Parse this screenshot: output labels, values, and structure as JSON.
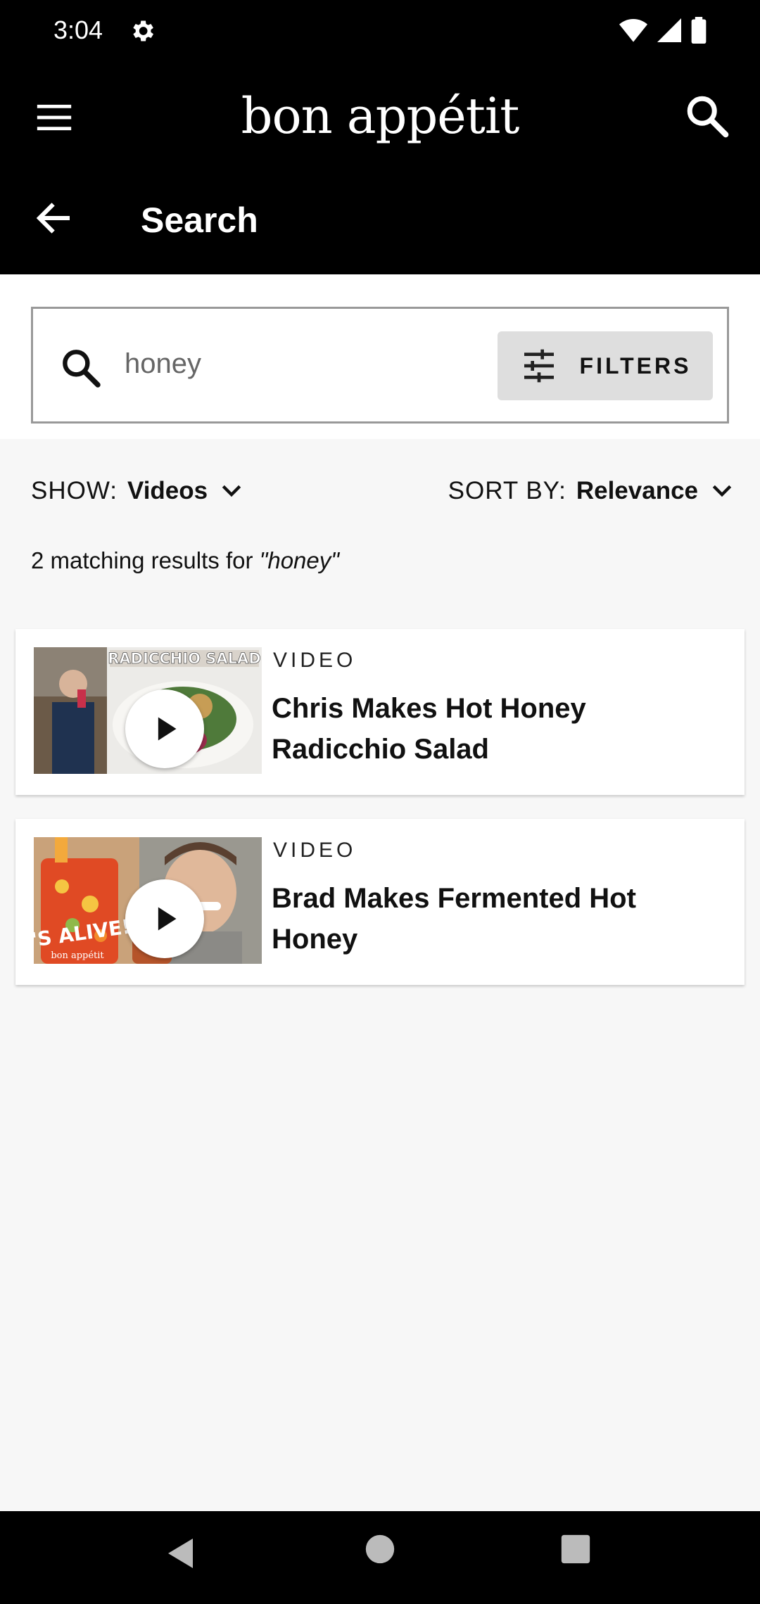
{
  "status_bar": {
    "time": "3:04"
  },
  "app_bar": {
    "brand": "bon appétit",
    "page_title": "Search"
  },
  "search": {
    "query": "honey",
    "filters_label": "FILTERS"
  },
  "controls": {
    "show_label": "SHOW:",
    "show_value": "Videos",
    "sort_label": "SORT BY:",
    "sort_value": "Relevance"
  },
  "results_summary": {
    "prefix": "2 matching results for ",
    "query": "\"honey\""
  },
  "results": [
    {
      "kind": "VIDEO",
      "title": "Chris Makes Hot Honey Radicchio Salad",
      "thumb_text": "RADICCHIO SALAD"
    },
    {
      "kind": "VIDEO",
      "title": "Brad Makes Fermented Hot Honey",
      "thumb_text": "IT'S ALIVE!",
      "thumb_subtext": "bon appétit"
    }
  ],
  "colors": {
    "header": "#000000",
    "background": "#f7f7f7",
    "filters_button": "#dedede"
  }
}
